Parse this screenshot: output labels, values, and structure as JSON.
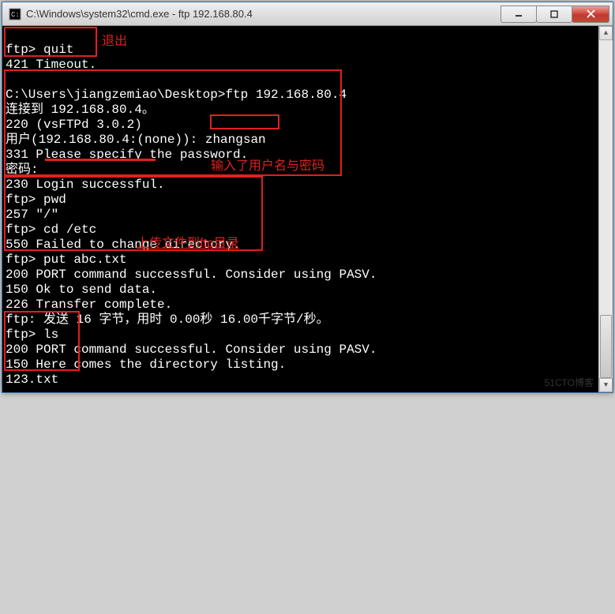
{
  "window": {
    "title": "C:\\Windows\\system32\\cmd.exe - ftp  192.168.80.4"
  },
  "terminal": {
    "lines": [
      "ftp> quit",
      "421 Timeout.",
      "",
      "C:\\Users\\jiangzemiao\\Desktop>ftp 192.168.80.4",
      "连接到 192.168.80.4。",
      "220 (vsFTPd 3.0.2)",
      "用户(192.168.80.4:(none)): zhangsan",
      "331 Please specify the password.",
      "密码:",
      "230 Login successful.",
      "ftp> pwd",
      "257 \"/\"",
      "ftp> cd /etc",
      "550 Failed to change directory.",
      "ftp> put abc.txt",
      "200 PORT command successful. Consider using PASV.",
      "150 Ok to send data.",
      "226 Transfer complete.",
      "ftp: 发送 16 字节，用时 0.00秒 16.00千字节/秒。",
      "ftp> ls",
      "200 PORT command successful. Consider using PASV.",
      "150 Here comes the directory listing.",
      "123.txt"
    ]
  },
  "annotations": {
    "quit": "退出",
    "login": "输入了用户名与密码",
    "upload": "上传文件到ftp目录"
  },
  "watermark": "51CTO博客"
}
